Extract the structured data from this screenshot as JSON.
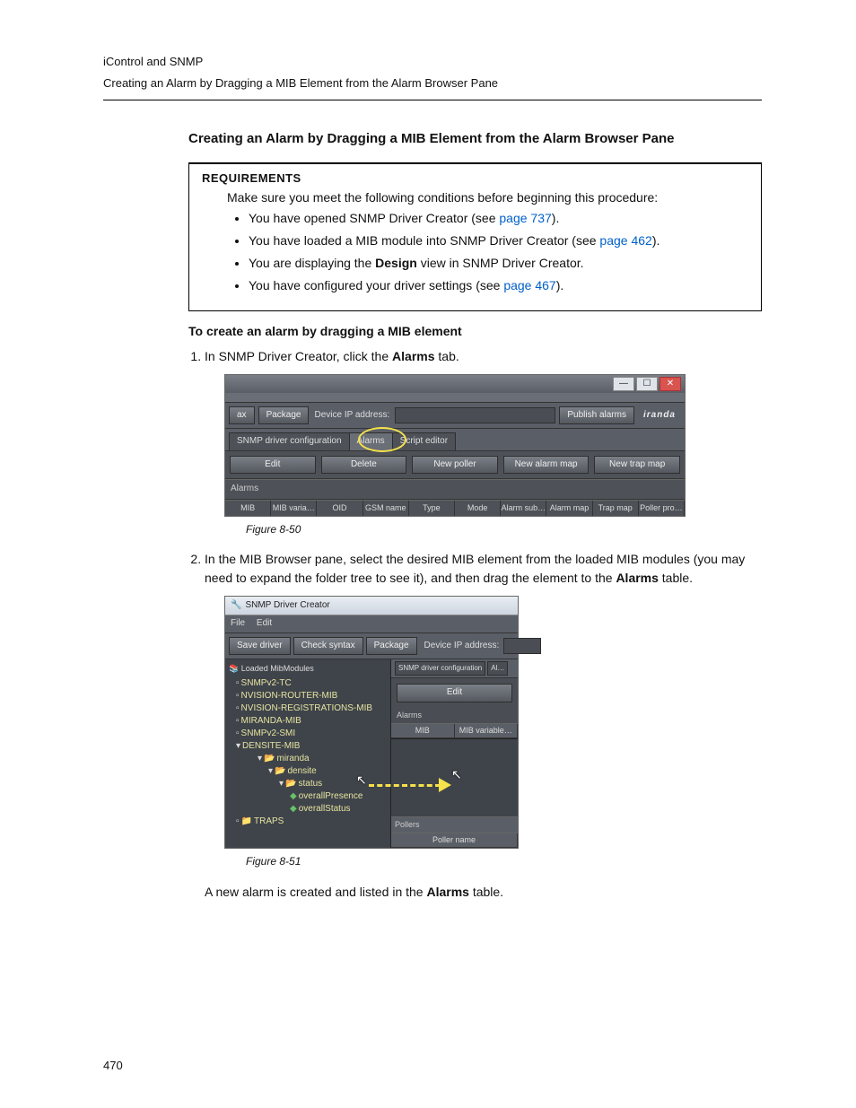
{
  "runhead": {
    "line1": "iControl and SNMP",
    "line2": "Creating an Alarm by Dragging a MIB Element from the Alarm Browser Pane"
  },
  "section_title": "Creating an Alarm by Dragging a MIB Element from the Alarm Browser Pane",
  "requirements": {
    "heading": "REQUIREMENTS",
    "lead": "Make sure you meet the following conditions before beginning this procedure:",
    "r1a": "You have opened SNMP Driver Creator (see ",
    "r1link": "page 737",
    "r1b": ").",
    "r2a": "You have loaded a MIB module into SNMP Driver Creator (see ",
    "r2link": "page 462",
    "r2b": ").",
    "r3a": "You are displaying the ",
    "r3b": "Design",
    "r3c": " view in SNMP Driver Creator.",
    "r4a": "You have configured your driver settings (see ",
    "r4link": "page 467",
    "r4b": ")."
  },
  "proc_title": "To create an alarm by dragging a MIB element",
  "step1": {
    "a": "In SNMP Driver Creator, click the ",
    "b": "Alarms",
    "c": " tab."
  },
  "fig1_caption": "Figure 8-50",
  "step2": {
    "text": "In the MIB Browser pane, select the desired MIB element from the loaded MIB modules (you may need to expand the folder tree to see it), and then drag the element to the ",
    "bold": "Alarms",
    "tail": " table."
  },
  "fig2_caption": "Figure 8-51",
  "result": {
    "a": "A new alarm is created and listed in the ",
    "b": "Alarms",
    "c": " table."
  },
  "page_number": "470",
  "shot1": {
    "ax": "ax",
    "package": "Package",
    "devip": "Device IP address:",
    "publish": "Publish alarms",
    "brand": "iranda",
    "tab1": "SNMP driver configuration",
    "tab2": "Alarms",
    "tab3": "Script editor",
    "edit": "Edit",
    "delete": "Delete",
    "newpoller": "New poller",
    "newalarmmap": "New alarm map",
    "newtrapmap": "New trap map",
    "panel": "Alarms",
    "cols": [
      "MIB",
      "MIB varia…",
      "OID",
      "GSM name",
      "Type",
      "Mode",
      "Alarm sub…",
      "Alarm map",
      "Trap map",
      "Poller pro…"
    ]
  },
  "shot2": {
    "title": "SNMP Driver Creator",
    "menu_file": "File",
    "menu_edit": "Edit",
    "save": "Save driver",
    "check": "Check syntax",
    "package": "Package",
    "devip": "Device IP address:",
    "treehdr": "Loaded MibModules",
    "nodes": {
      "n1": "SNMPv2-TC",
      "n2": "NVISION-ROUTER-MIB",
      "n3": "NVISION-REGISTRATIONS-MIB",
      "n4": "MIRANDA-MIB",
      "n5": "SNMPv2-SMI",
      "n6": "DENSITE-MIB",
      "n6a": "miranda",
      "n6b": "densite",
      "n6c": "status",
      "n6d": "overallPresence",
      "n6e": "overallStatus",
      "n7": "TRAPS"
    },
    "rtab1": "SNMP driver configuration",
    "rtab2": "Al…",
    "edit": "Edit",
    "alarms": "Alarms",
    "col1": "MIB",
    "col2": "MIB variable…",
    "pollers": "Pollers",
    "pollername": "Poller name"
  }
}
